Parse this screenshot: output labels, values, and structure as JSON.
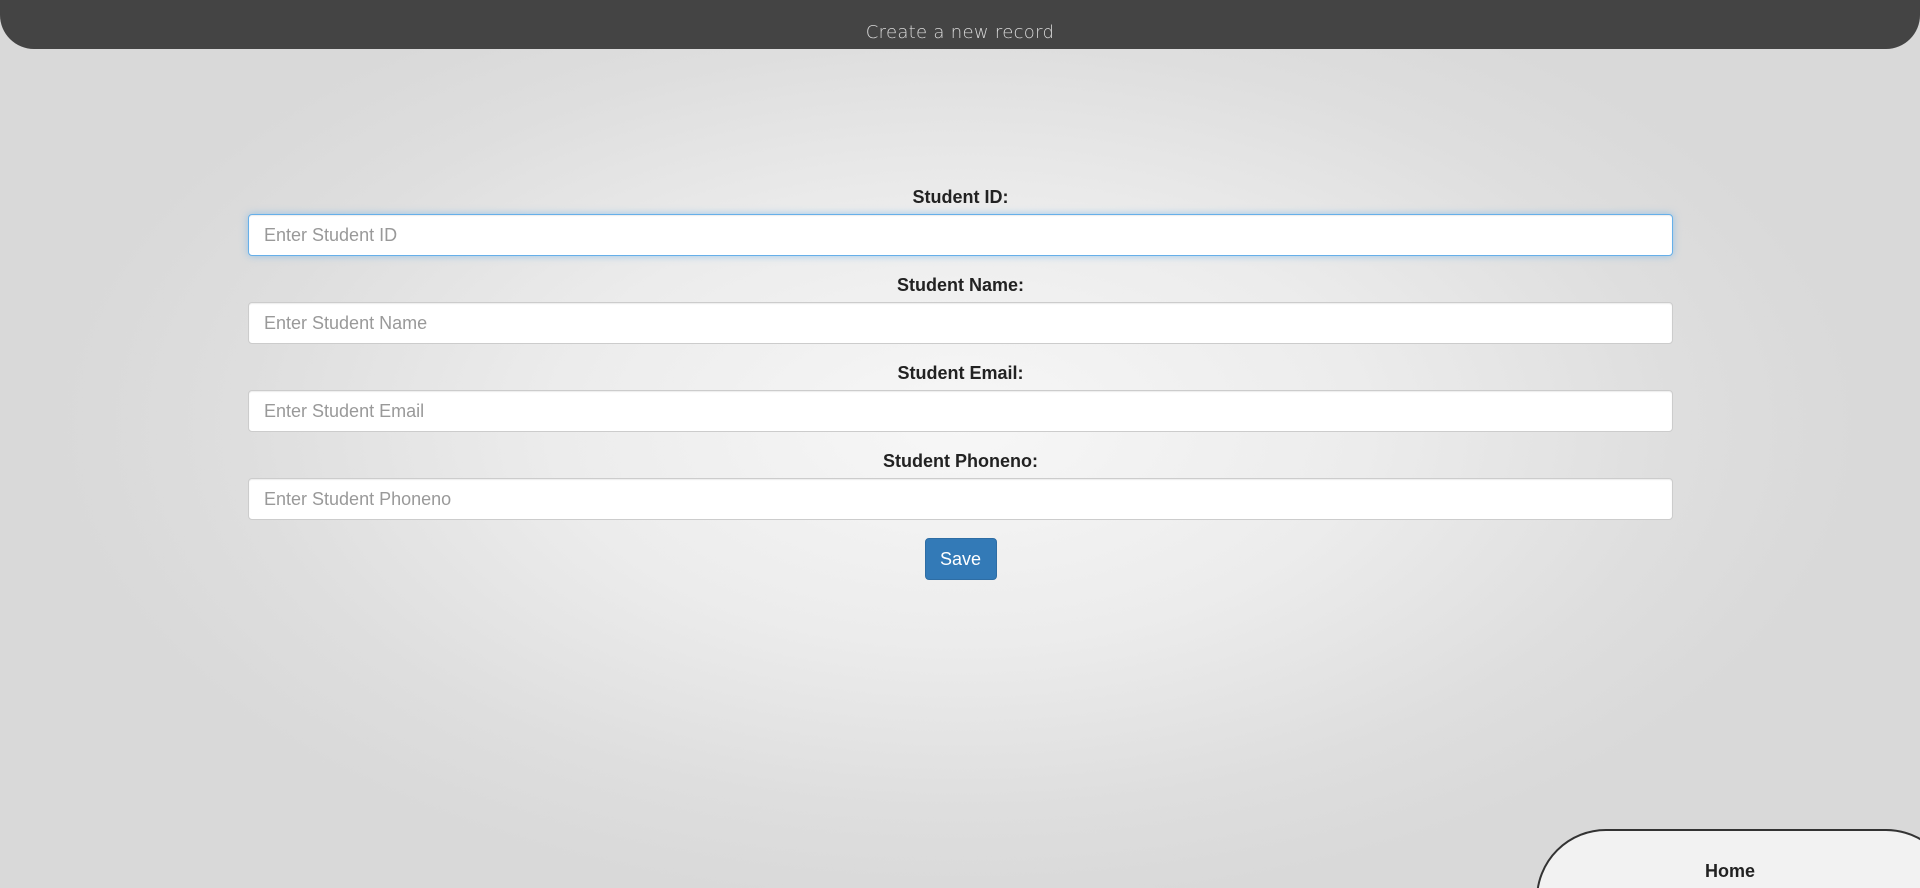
{
  "header": {
    "title": "Create a new record"
  },
  "form": {
    "fields": [
      {
        "label": "Student ID:",
        "placeholder": "Enter Student ID",
        "value": ""
      },
      {
        "label": "Student Name:",
        "placeholder": "Enter Student Name",
        "value": ""
      },
      {
        "label": "Student Email:",
        "placeholder": "Enter Student Email",
        "value": ""
      },
      {
        "label": "Student Phoneno:",
        "placeholder": "Enter Student Phoneno",
        "value": ""
      }
    ],
    "save_label": "Save"
  },
  "nav": {
    "home_label": "Home"
  },
  "colors": {
    "header_bg": "#444444",
    "save_button": "#337ab7",
    "focus_border": "#66afe9"
  }
}
